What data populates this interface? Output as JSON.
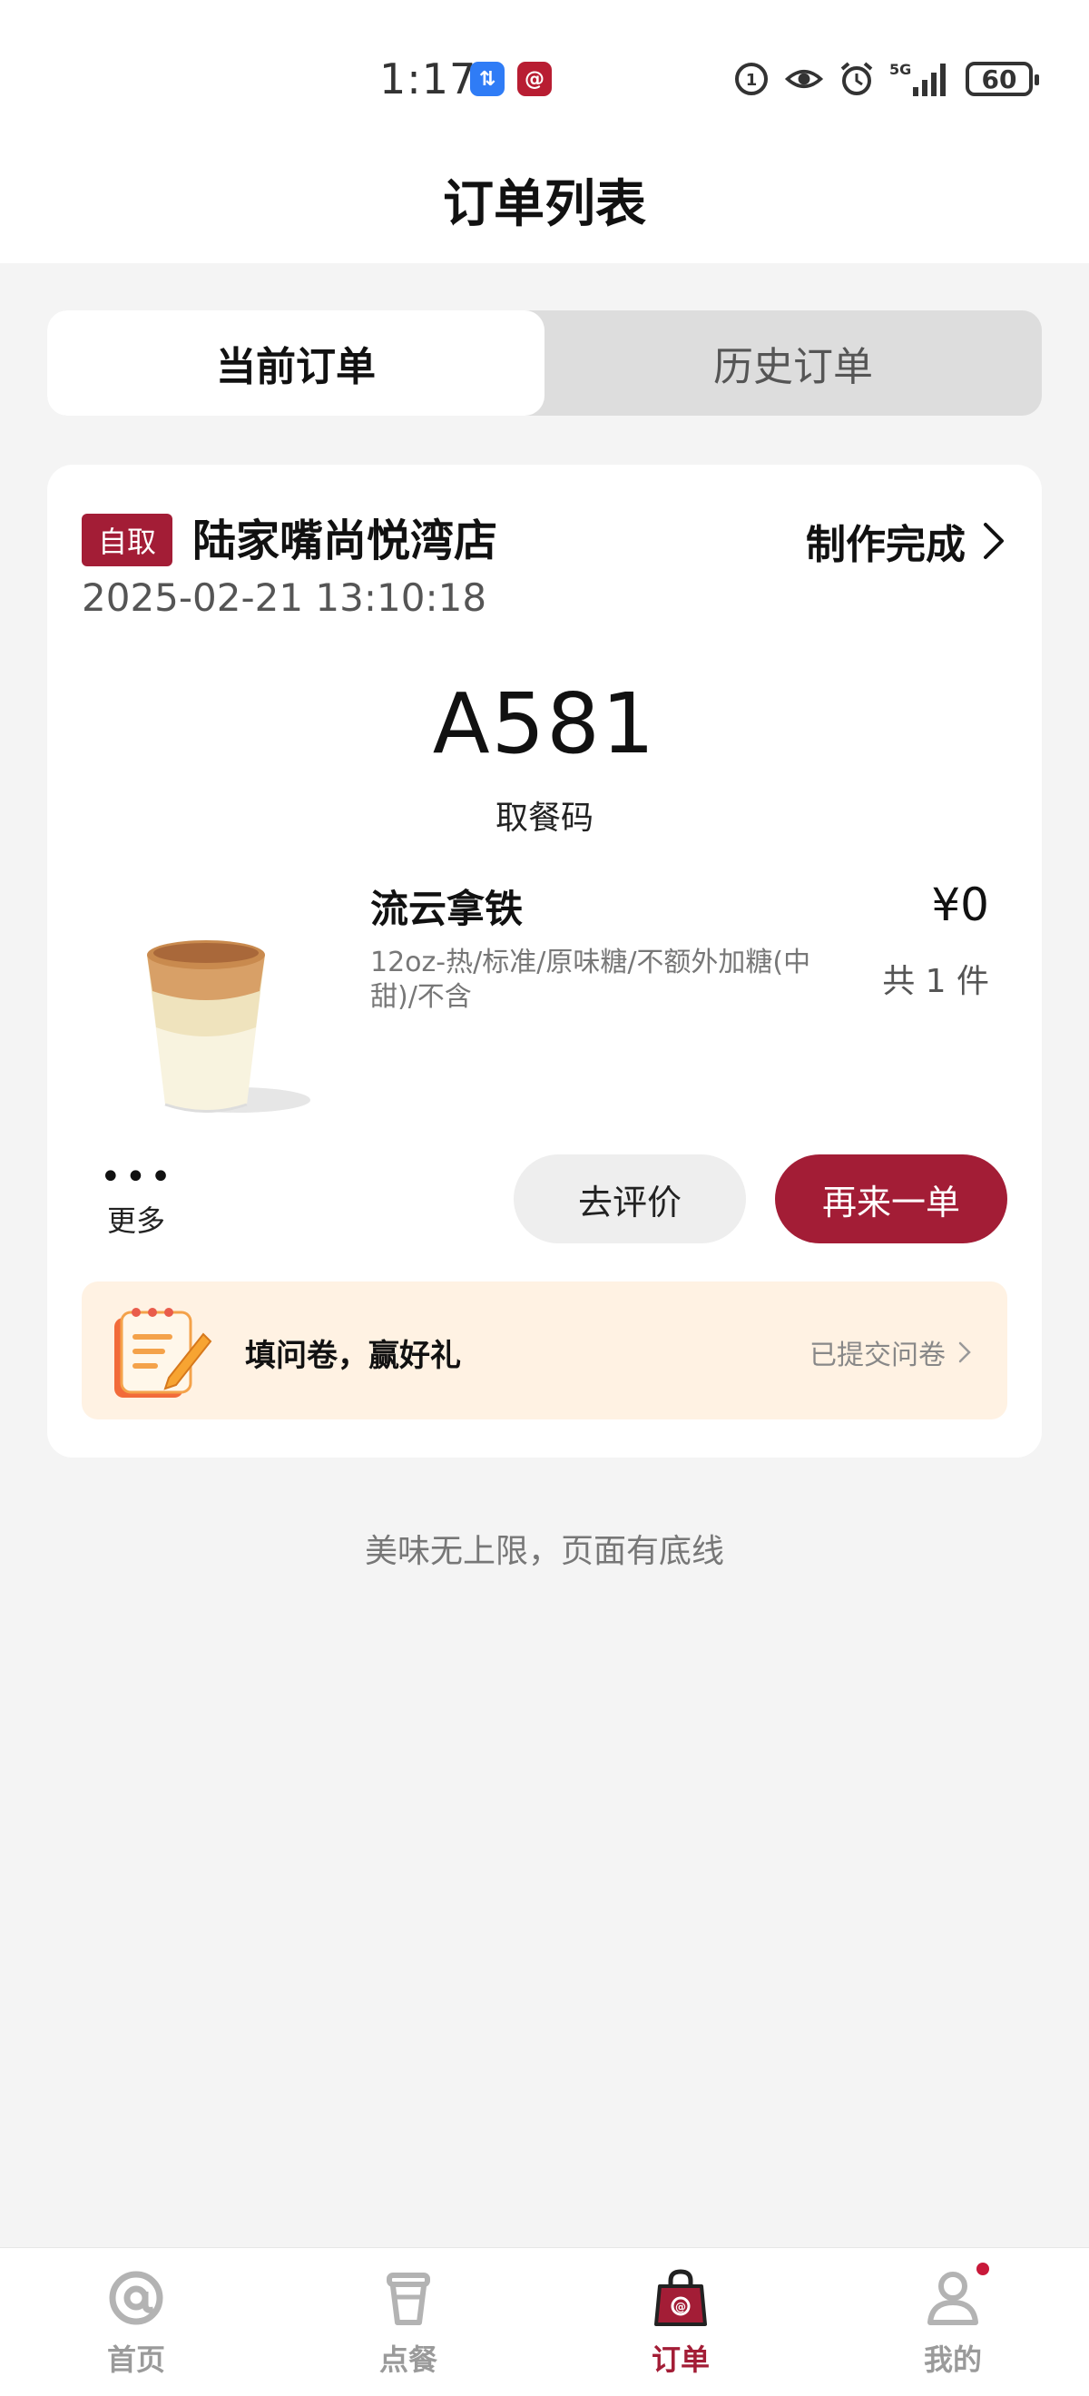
{
  "status_bar": {
    "time": "1:17",
    "battery": "60",
    "network": "5G",
    "icons": [
      "transfer-app-icon",
      "luckin-app-icon",
      "hd-icon",
      "eye-icon",
      "alarm-icon",
      "signal-icon",
      "battery-icon"
    ]
  },
  "header": {
    "title": "订单列表"
  },
  "tabs": [
    {
      "label": "当前订单",
      "active": true
    },
    {
      "label": "历史订单",
      "active": false
    }
  ],
  "order": {
    "tag": "自取",
    "store_name": "陆家嘴尚悦湾店",
    "status": "制作完成",
    "time": "2025-02-21 13:10:18",
    "pickup_code": "A581",
    "pickup_label": "取餐码",
    "product": {
      "name": "流云拿铁",
      "spec": "12oz-热/标准/原味糖/不额外加糖(中甜)/不含",
      "price": "¥0",
      "quantity": "共 1 件"
    },
    "more_label": "更多",
    "review_button": "去评价",
    "reorder_button": "再来一单",
    "survey": {
      "text": "填问卷，赢好礼",
      "link": "已提交问卷"
    }
  },
  "footer_note": "美味无上限，页面有底线",
  "bottom_nav": [
    {
      "label": "首页",
      "icon": "home-at-icon",
      "active": false
    },
    {
      "label": "点餐",
      "icon": "cup-icon",
      "active": false
    },
    {
      "label": "订单",
      "icon": "bag-icon",
      "active": true
    },
    {
      "label": "我的",
      "icon": "profile-icon",
      "active": false,
      "badge": true
    }
  ],
  "colors": {
    "brand": "#a31d36",
    "survey_bg": "#fff2e3",
    "page_bg": "#f4f4f4"
  }
}
